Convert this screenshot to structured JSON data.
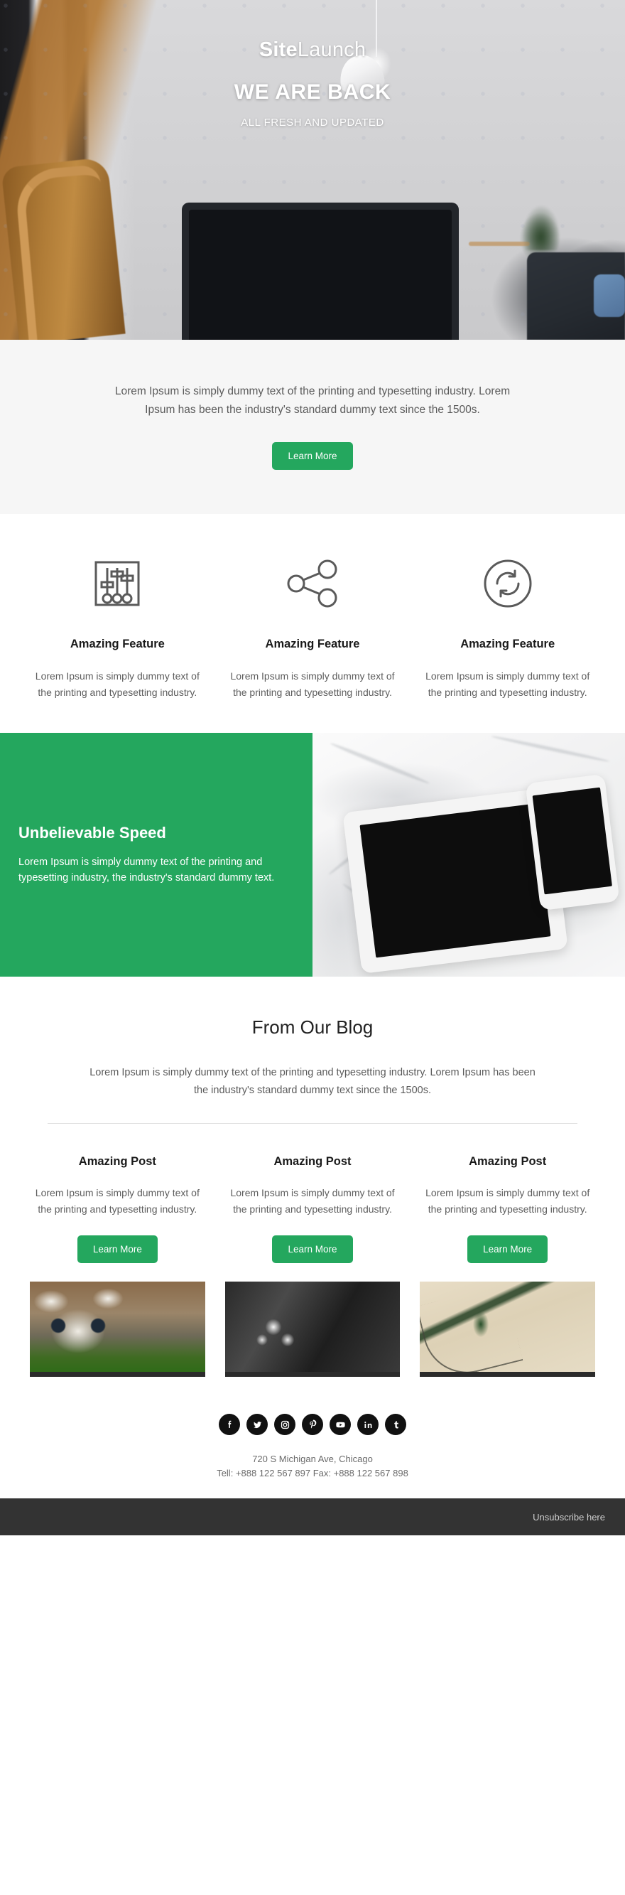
{
  "hero": {
    "brand_bold": "Site",
    "brand_light": "Launch",
    "headline": "WE ARE BACK",
    "subheadline": "ALL FRESH AND UPDATED",
    "image_alt": "living-room-with-monitor-photo"
  },
  "intro": {
    "text": "Lorem Ipsum is simply dummy text of the printing and typesetting industry. Lorem Ipsum has been the industry's standard dummy text since the 1500s.",
    "button_label": "Learn More"
  },
  "features": [
    {
      "icon": "equalizer-sliders-icon",
      "title": "Amazing Feature",
      "text": "Lorem Ipsum is simply dummy text of the printing and typesetting industry."
    },
    {
      "icon": "share-nodes-icon",
      "title": "Amazing Feature",
      "text": "Lorem Ipsum is simply dummy text of the printing and typesetting industry."
    },
    {
      "icon": "refresh-sync-circle-icon",
      "title": "Amazing Feature",
      "text": "Lorem Ipsum is simply dummy text of the printing and typesetting industry."
    }
  ],
  "speed": {
    "title": "Unbelievable Speed",
    "text": "Lorem Ipsum is simply dummy text of the printing and typesetting industry, the industry's standard dummy text.",
    "image_alt": "tablet-and-phone-on-marble-photo"
  },
  "blog": {
    "title": "From Our Blog",
    "intro": "Lorem Ipsum is simply dummy text of the printing and typesetting industry. Lorem Ipsum has been the industry's standard dummy text since the 1500s.",
    "posts": [
      {
        "title": "Amazing Post",
        "text": "Lorem Ipsum is simply dummy text of the printing and typesetting industry.",
        "button_label": "Learn More",
        "image_alt": "raccoon-in-grass-photo"
      },
      {
        "title": "Amazing Post",
        "text": "Lorem Ipsum is simply dummy text of the printing and typesetting industry.",
        "button_label": "Learn More",
        "image_alt": "black-and-white-flowers-photo"
      },
      {
        "title": "Amazing Post",
        "text": "Lorem Ipsum is simply dummy text of the printing and typesetting industry.",
        "button_label": "Learn More",
        "image_alt": "aerial-river-landscape-photo"
      }
    ]
  },
  "footer": {
    "socials": [
      "facebook-icon",
      "twitter-icon",
      "instagram-icon",
      "pinterest-icon",
      "youtube-icon",
      "linkedin-icon",
      "tumblr-icon"
    ],
    "address_line1": "720 S Michigan Ave, Chicago",
    "address_line2": "Tell: +888 122 567 897 Fax: +888 122 567 898",
    "unsubscribe_label": "Unsubscribe here"
  },
  "colors": {
    "accent_green": "#24a75e",
    "intro_background": "#f6f6f6",
    "bottom_bar": "#333333",
    "icon_stroke": "#5a5a5a"
  }
}
